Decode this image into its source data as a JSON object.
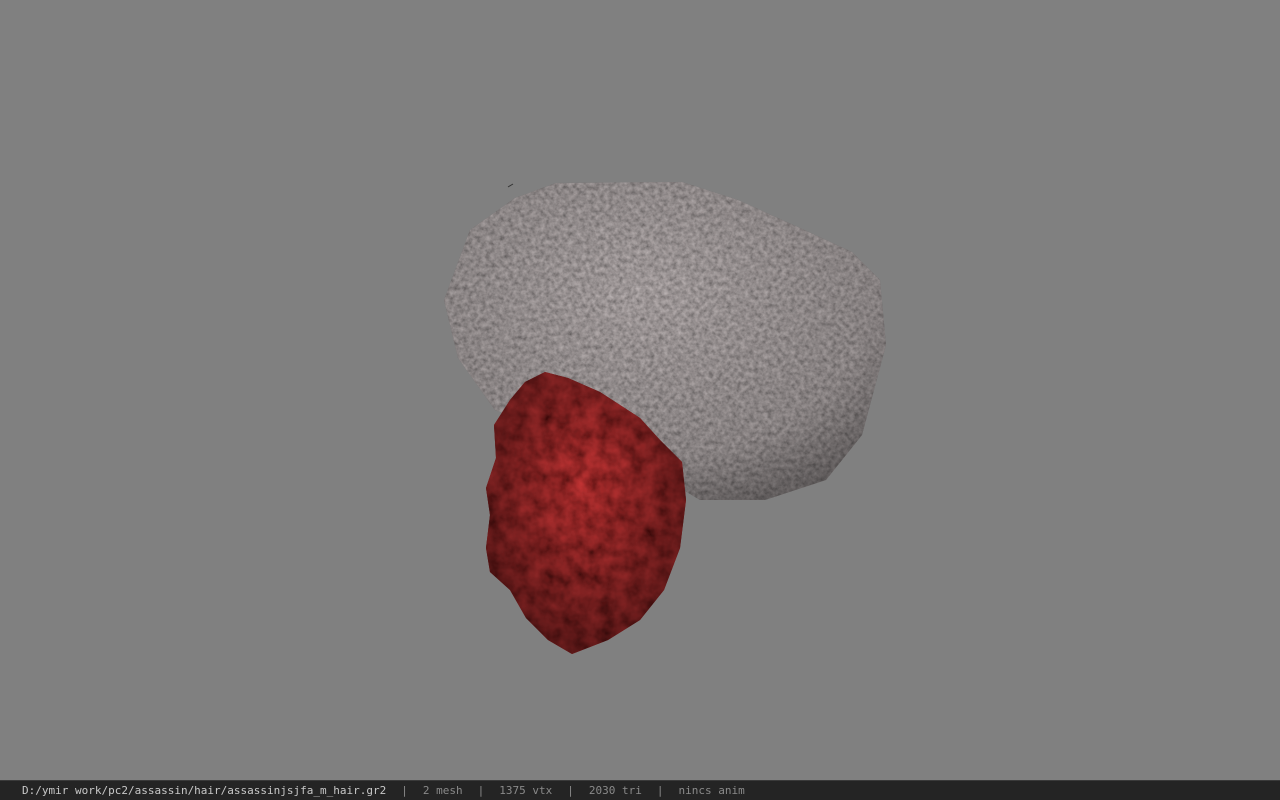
{
  "viewport": {
    "background": "#808080",
    "model": {
      "parts": [
        {
          "name": "hair-cap",
          "color": "#5a5455",
          "texture": "grey stone-like noise"
        },
        {
          "name": "hair-ponytail",
          "color": "#5a0c0c",
          "texture": "dark red clumps"
        }
      ]
    }
  },
  "statusbar": {
    "file_path": "D:/ymir work/pc2/assassin/hair/assassinjsjfa_m_hair.gr2",
    "separator": "|",
    "mesh_count": "2 mesh",
    "vertex_count": "1375 vtx",
    "triangle_count": "2030 tri",
    "anim_status": "nincs anim"
  }
}
